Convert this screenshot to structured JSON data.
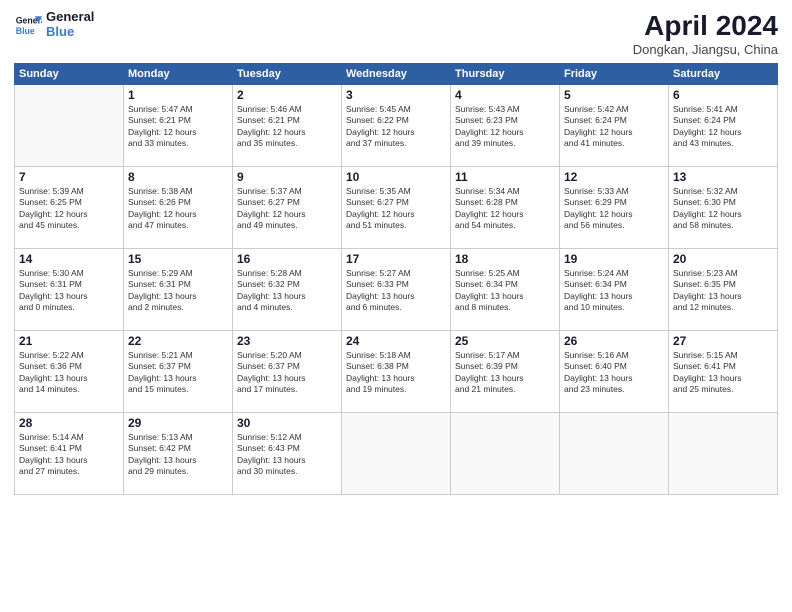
{
  "header": {
    "logo_line1": "General",
    "logo_line2": "Blue",
    "title": "April 2024",
    "subtitle": "Dongkan, Jiangsu, China"
  },
  "weekdays": [
    "Sunday",
    "Monday",
    "Tuesday",
    "Wednesday",
    "Thursday",
    "Friday",
    "Saturday"
  ],
  "weeks": [
    [
      {
        "num": "",
        "info": ""
      },
      {
        "num": "1",
        "info": "Sunrise: 5:47 AM\nSunset: 6:21 PM\nDaylight: 12 hours\nand 33 minutes."
      },
      {
        "num": "2",
        "info": "Sunrise: 5:46 AM\nSunset: 6:21 PM\nDaylight: 12 hours\nand 35 minutes."
      },
      {
        "num": "3",
        "info": "Sunrise: 5:45 AM\nSunset: 6:22 PM\nDaylight: 12 hours\nand 37 minutes."
      },
      {
        "num": "4",
        "info": "Sunrise: 5:43 AM\nSunset: 6:23 PM\nDaylight: 12 hours\nand 39 minutes."
      },
      {
        "num": "5",
        "info": "Sunrise: 5:42 AM\nSunset: 6:24 PM\nDaylight: 12 hours\nand 41 minutes."
      },
      {
        "num": "6",
        "info": "Sunrise: 5:41 AM\nSunset: 6:24 PM\nDaylight: 12 hours\nand 43 minutes."
      }
    ],
    [
      {
        "num": "7",
        "info": "Sunrise: 5:39 AM\nSunset: 6:25 PM\nDaylight: 12 hours\nand 45 minutes."
      },
      {
        "num": "8",
        "info": "Sunrise: 5:38 AM\nSunset: 6:26 PM\nDaylight: 12 hours\nand 47 minutes."
      },
      {
        "num": "9",
        "info": "Sunrise: 5:37 AM\nSunset: 6:27 PM\nDaylight: 12 hours\nand 49 minutes."
      },
      {
        "num": "10",
        "info": "Sunrise: 5:35 AM\nSunset: 6:27 PM\nDaylight: 12 hours\nand 51 minutes."
      },
      {
        "num": "11",
        "info": "Sunrise: 5:34 AM\nSunset: 6:28 PM\nDaylight: 12 hours\nand 54 minutes."
      },
      {
        "num": "12",
        "info": "Sunrise: 5:33 AM\nSunset: 6:29 PM\nDaylight: 12 hours\nand 56 minutes."
      },
      {
        "num": "13",
        "info": "Sunrise: 5:32 AM\nSunset: 6:30 PM\nDaylight: 12 hours\nand 58 minutes."
      }
    ],
    [
      {
        "num": "14",
        "info": "Sunrise: 5:30 AM\nSunset: 6:31 PM\nDaylight: 13 hours\nand 0 minutes."
      },
      {
        "num": "15",
        "info": "Sunrise: 5:29 AM\nSunset: 6:31 PM\nDaylight: 13 hours\nand 2 minutes."
      },
      {
        "num": "16",
        "info": "Sunrise: 5:28 AM\nSunset: 6:32 PM\nDaylight: 13 hours\nand 4 minutes."
      },
      {
        "num": "17",
        "info": "Sunrise: 5:27 AM\nSunset: 6:33 PM\nDaylight: 13 hours\nand 6 minutes."
      },
      {
        "num": "18",
        "info": "Sunrise: 5:25 AM\nSunset: 6:34 PM\nDaylight: 13 hours\nand 8 minutes."
      },
      {
        "num": "19",
        "info": "Sunrise: 5:24 AM\nSunset: 6:34 PM\nDaylight: 13 hours\nand 10 minutes."
      },
      {
        "num": "20",
        "info": "Sunrise: 5:23 AM\nSunset: 6:35 PM\nDaylight: 13 hours\nand 12 minutes."
      }
    ],
    [
      {
        "num": "21",
        "info": "Sunrise: 5:22 AM\nSunset: 6:36 PM\nDaylight: 13 hours\nand 14 minutes."
      },
      {
        "num": "22",
        "info": "Sunrise: 5:21 AM\nSunset: 6:37 PM\nDaylight: 13 hours\nand 15 minutes."
      },
      {
        "num": "23",
        "info": "Sunrise: 5:20 AM\nSunset: 6:37 PM\nDaylight: 13 hours\nand 17 minutes."
      },
      {
        "num": "24",
        "info": "Sunrise: 5:18 AM\nSunset: 6:38 PM\nDaylight: 13 hours\nand 19 minutes."
      },
      {
        "num": "25",
        "info": "Sunrise: 5:17 AM\nSunset: 6:39 PM\nDaylight: 13 hours\nand 21 minutes."
      },
      {
        "num": "26",
        "info": "Sunrise: 5:16 AM\nSunset: 6:40 PM\nDaylight: 13 hours\nand 23 minutes."
      },
      {
        "num": "27",
        "info": "Sunrise: 5:15 AM\nSunset: 6:41 PM\nDaylight: 13 hours\nand 25 minutes."
      }
    ],
    [
      {
        "num": "28",
        "info": "Sunrise: 5:14 AM\nSunset: 6:41 PM\nDaylight: 13 hours\nand 27 minutes."
      },
      {
        "num": "29",
        "info": "Sunrise: 5:13 AM\nSunset: 6:42 PM\nDaylight: 13 hours\nand 29 minutes."
      },
      {
        "num": "30",
        "info": "Sunrise: 5:12 AM\nSunset: 6:43 PM\nDaylight: 13 hours\nand 30 minutes."
      },
      {
        "num": "",
        "info": ""
      },
      {
        "num": "",
        "info": ""
      },
      {
        "num": "",
        "info": ""
      },
      {
        "num": "",
        "info": ""
      }
    ]
  ]
}
